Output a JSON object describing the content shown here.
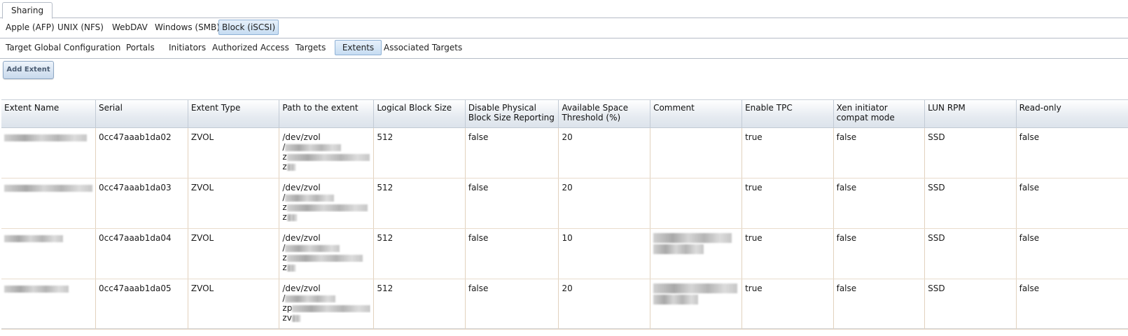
{
  "top_tab": "Sharing",
  "protocol_tabs": [
    "Apple (AFP)",
    "UNIX (NFS)",
    "WebDAV",
    "Windows (SMB)",
    "Block (iSCSI)"
  ],
  "iscsi_tabs": [
    "Target Global Configuration",
    "Portals",
    "Initiators",
    "Authorized Access",
    "Targets",
    "Extents",
    "Associated Targets"
  ],
  "active_iscsi_tab": "Extents",
  "add_button": "Add Extent",
  "columns": [
    "Extent Name",
    "Serial",
    "Extent Type",
    "Path to the extent",
    "Logical Block Size",
    "Disable Physical Block Size Reporting",
    "Available Space Threshold (%)",
    "Comment",
    "Enable TPC",
    "Xen initiator compat mode",
    "LUN RPM",
    "Read-only"
  ],
  "rows": [
    {
      "serial": "0cc47aaab1da02",
      "type": "ZVOL",
      "path1": "/dev/zvol",
      "path2": "/",
      "path3": "z",
      "path4": "z",
      "block_size": "512",
      "disable_pbs": "false",
      "threshold": "20",
      "tpc": "true",
      "xen": "false",
      "rpm": "SSD",
      "readonly": "false"
    },
    {
      "serial": "0cc47aaab1da03",
      "type": "ZVOL",
      "path1": "/dev/zvol",
      "path2": "/",
      "path3": "z",
      "path4": "z",
      "block_size": "512",
      "disable_pbs": "false",
      "threshold": "20",
      "tpc": "true",
      "xen": "false",
      "rpm": "SSD",
      "readonly": "false"
    },
    {
      "serial": "0cc47aaab1da04",
      "type": "ZVOL",
      "path1": "/dev/zvol",
      "path2": "/",
      "path3": "z",
      "path4": "z",
      "block_size": "512",
      "disable_pbs": "false",
      "threshold": "10",
      "tpc": "true",
      "xen": "false",
      "rpm": "SSD",
      "readonly": "false"
    },
    {
      "serial": "0cc47aaab1da05",
      "type": "ZVOL",
      "path1": "/dev/zvol",
      "path2": "/",
      "path3": "zp",
      "path4": "zv",
      "block_size": "512",
      "disable_pbs": "false",
      "threshold": "20",
      "tpc": "true",
      "xen": "false",
      "rpm": "SSD",
      "readonly": "false"
    }
  ]
}
